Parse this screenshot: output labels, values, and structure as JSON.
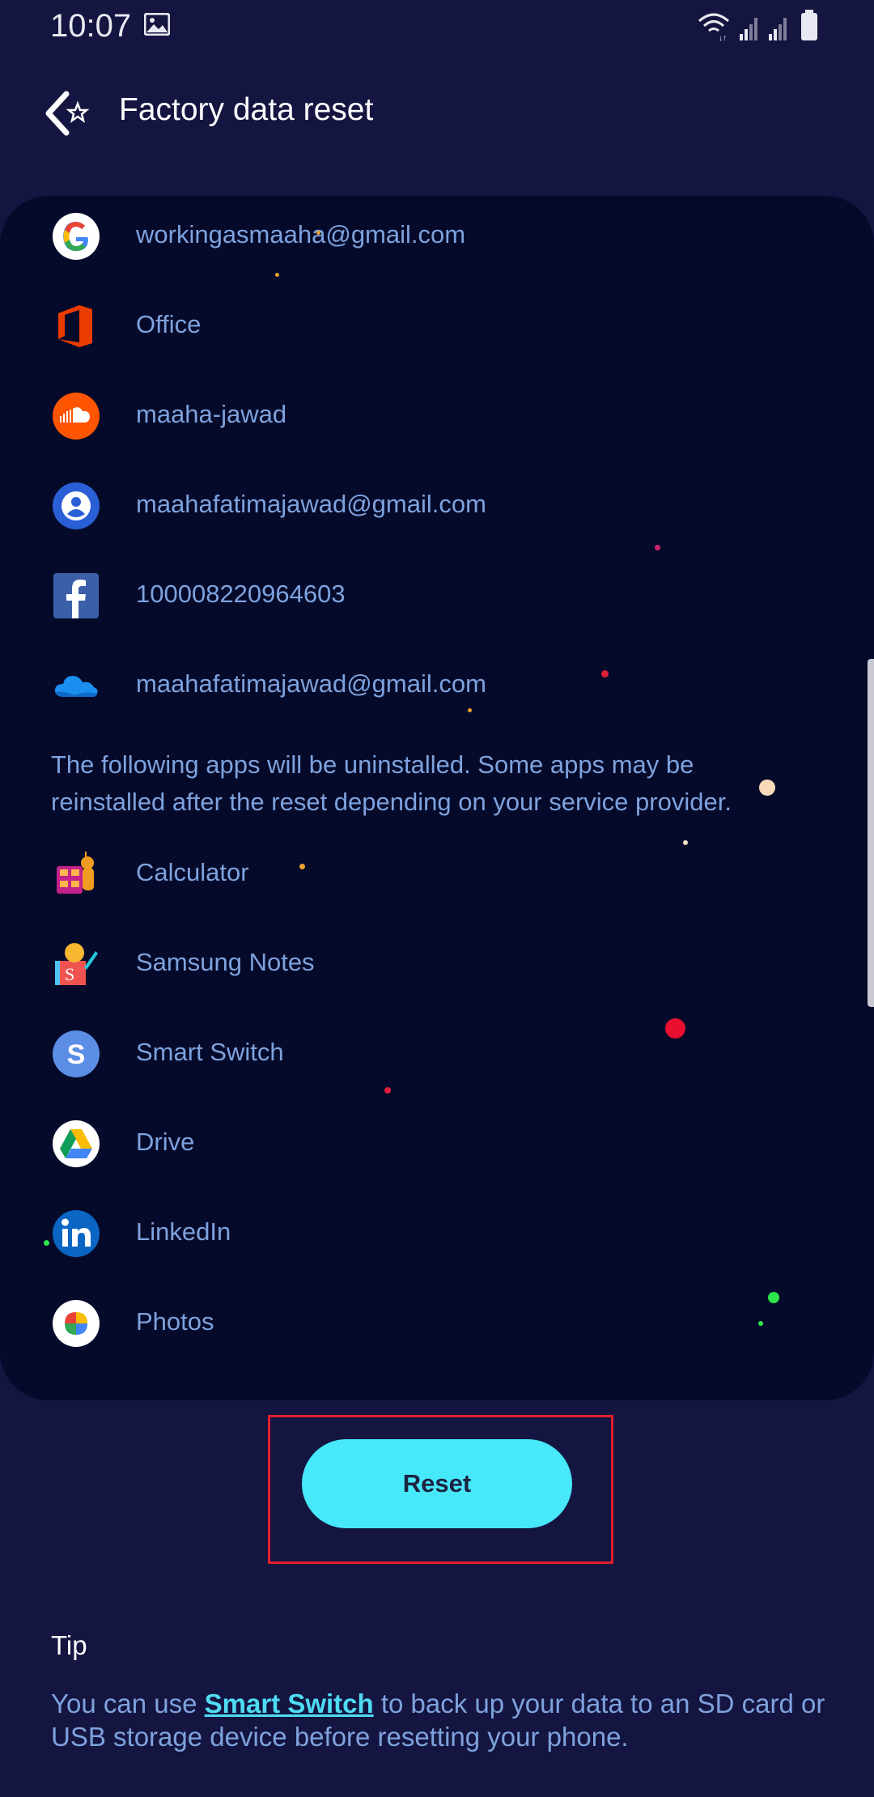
{
  "status_bar": {
    "time": "10:07"
  },
  "header": {
    "title": "Factory data reset"
  },
  "accounts": [
    {
      "icon": "google-icon",
      "label": "workingasmaaha@gmail.com"
    },
    {
      "icon": "office-icon",
      "label": "Office"
    },
    {
      "icon": "soundcloud-icon",
      "label": "maaha-jawad"
    },
    {
      "icon": "samsung-account-icon",
      "label": "maahafatimajawad@gmail.com"
    },
    {
      "icon": "facebook-icon",
      "label": "100008220964603"
    },
    {
      "icon": "onedrive-icon",
      "label": "maahafatimajawad@gmail.com"
    }
  ],
  "apps_note": "The following apps will be uninstalled. Some apps may be reinstalled after the reset depending on your service provider.",
  "apps": [
    {
      "icon": "calculator-icon",
      "label": "Calculator"
    },
    {
      "icon": "samsung-notes-icon",
      "label": "Samsung Notes"
    },
    {
      "icon": "smart-switch-icon",
      "label": "Smart Switch"
    },
    {
      "icon": "drive-icon",
      "label": "Drive"
    },
    {
      "icon": "linkedin-icon",
      "label": "LinkedIn"
    },
    {
      "icon": "photos-icon",
      "label": "Photos"
    }
  ],
  "reset_button": {
    "label": "Reset"
  },
  "tip": {
    "title": "Tip",
    "text_before": "You can use ",
    "link": "Smart Switch",
    "text_after": " to back up your data to an SD card or USB storage device before resetting your phone."
  },
  "colors": {
    "background": "#141540",
    "card": "#050a2a",
    "accent": "#46e8fa",
    "text_secondary": "#7ea2dd",
    "highlight_border": "#e0202d"
  }
}
